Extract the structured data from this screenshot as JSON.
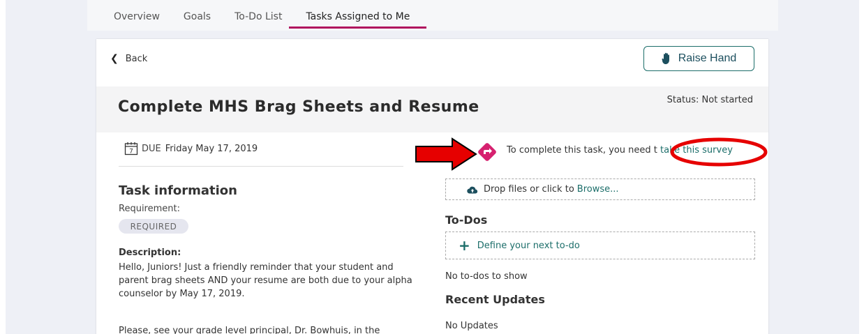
{
  "tabs": [
    {
      "label": "Overview"
    },
    {
      "label": "Goals"
    },
    {
      "label": "To-Do List"
    },
    {
      "label": "Tasks Assigned to Me"
    }
  ],
  "header": {
    "back_label": "Back",
    "raise_hand_label": "Raise Hand"
  },
  "task": {
    "title": "Complete MHS Brag Sheets and Resume",
    "status": "Status: Not started",
    "due_label": "DUE",
    "due_date": "Friday May 17, 2019",
    "calendar_day": "7"
  },
  "survey": {
    "text": "To complete this task, you need t",
    "link": "take this survey"
  },
  "task_info": {
    "heading": "Task information",
    "requirement_label": "Requirement:",
    "requirement_badge": "REQUIRED",
    "description_label": "Description:",
    "description": "Hello, Juniors!  Just a friendly reminder that your student and parent brag sheets AND your resume are both due to your alpha counselor by May 17, 2019.",
    "description_more": "Please, see your grade level principal, Dr. Bowhuis, in the"
  },
  "upload": {
    "prompt": "Drop files or click to",
    "browse_link": "Browse..."
  },
  "todos": {
    "heading": "To-Dos",
    "define_label": "Define your next to-do",
    "empty": "No to-dos to show"
  },
  "updates": {
    "heading": "Recent Updates",
    "empty": "No Updates"
  },
  "colors": {
    "accent_teal": "#1c6e6a",
    "tab_underline": "#b0125e",
    "survey_icon": "#d6216f",
    "annotation_red": "#e60000"
  }
}
